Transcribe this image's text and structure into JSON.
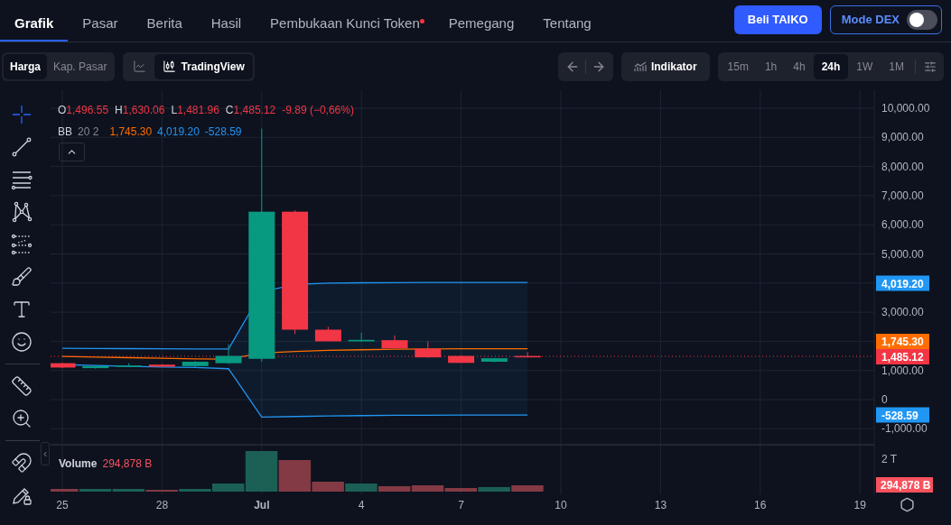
{
  "nav": {
    "tabs": [
      {
        "label": "Grafik",
        "selected": true,
        "dot": false
      },
      {
        "label": "Pasar",
        "selected": false,
        "dot": false
      },
      {
        "label": "Berita",
        "selected": false,
        "dot": false
      },
      {
        "label": "Hasil",
        "selected": false,
        "dot": false
      },
      {
        "label": "Pembukaan Kunci Token",
        "selected": false,
        "dot": true
      },
      {
        "label": "Pemegang",
        "selected": false,
        "dot": false
      },
      {
        "label": "Tentang",
        "selected": false,
        "dot": false
      }
    ],
    "buy_button": "Beli TAIKO",
    "mode_toggle": {
      "label": "Mode DEX",
      "on": false
    }
  },
  "toolbar": {
    "price_mode": [
      {
        "label": "Harga",
        "selected": true
      },
      {
        "label": "Kap. Pasar",
        "selected": false
      }
    ],
    "chart_type": [
      {
        "kind": "line",
        "selected": false
      },
      {
        "kind": "candles",
        "label": "TradingView",
        "selected": true
      }
    ],
    "indicator_button": "Indikator",
    "timeframes": [
      {
        "label": "15m",
        "selected": false
      },
      {
        "label": "1h",
        "selected": false
      },
      {
        "label": "4h",
        "selected": false
      },
      {
        "label": "24h",
        "selected": true
      },
      {
        "label": "1W",
        "selected": false
      },
      {
        "label": "1M",
        "selected": false
      }
    ]
  },
  "drawing_tools": [
    {
      "kind": "crosshair",
      "selected": true
    },
    {
      "kind": "trend_line",
      "selected": false
    },
    {
      "kind": "horizontal_lines",
      "selected": false
    },
    {
      "kind": "pattern",
      "selected": false
    },
    {
      "kind": "fib",
      "selected": false
    },
    {
      "kind": "brush",
      "selected": false
    },
    {
      "kind": "text",
      "selected": false
    },
    {
      "kind": "emoji",
      "selected": false
    },
    {
      "kind": "divider"
    },
    {
      "kind": "ruler",
      "selected": false
    },
    {
      "kind": "zoom",
      "selected": false
    },
    {
      "kind": "divider"
    },
    {
      "kind": "magnet",
      "selected": false
    },
    {
      "kind": "lock_drawings",
      "selected": false
    }
  ],
  "chart": {
    "legend": {
      "ohlc": [
        {
          "label": "O",
          "value": "1,496.55"
        },
        {
          "label": "H",
          "value": "1,630.06"
        },
        {
          "label": "L",
          "value": "1,481.96"
        },
        {
          "label": "C",
          "value": "1,485.12"
        }
      ],
      "change": "-9.89 (−0,66%)",
      "bb": {
        "name": "BB",
        "params": "20 2",
        "values": [
          {
            "text": "1,745.30",
            "color": "#ff6d00"
          },
          {
            "text": "4,019.20",
            "color": "#2196f3"
          },
          {
            "text": "-528.59",
            "color": "#2196f3"
          }
        ]
      }
    },
    "price_tags": [
      {
        "text": "4,019.20",
        "color": "#2196f3"
      },
      {
        "text": "1,745.30",
        "color": "#ff6d00"
      },
      {
        "text": "1,485.12",
        "color": "#f23645"
      },
      {
        "text": "-528.59",
        "color": "#2196f3"
      }
    ],
    "price_axis": [
      "10,000.00",
      "9,000.00",
      "8,000.00",
      "7,000.00",
      "6,000.00",
      "5,000.00",
      "3,000.00",
      "1,000.00",
      "0",
      "-1,000.00"
    ],
    "date_axis": [
      "25",
      "28",
      "Jul",
      "4",
      "7",
      "10",
      "13",
      "16",
      "19"
    ],
    "volume": {
      "label": "Volume",
      "value": "294,878 B",
      "axis_label": "2 T",
      "tag": {
        "text": "294,878 B",
        "color": "#f7525f"
      }
    }
  }
}
